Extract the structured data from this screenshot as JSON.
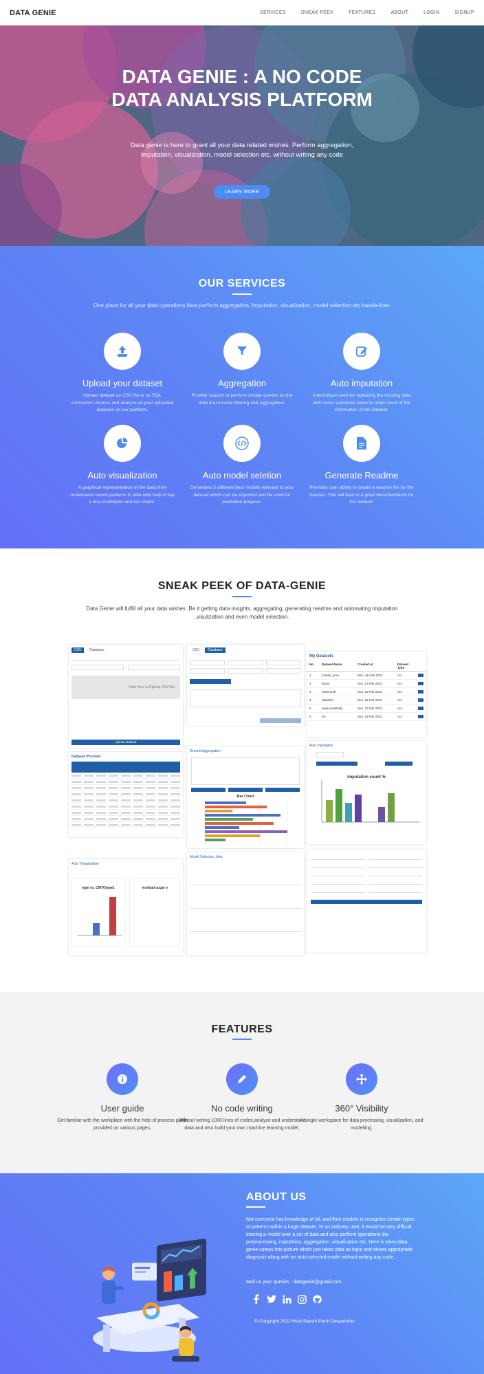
{
  "nav": {
    "brand": "DATA GENIE",
    "links": [
      "SERVICES",
      "SNEAK PEEK",
      "FEATURES",
      "ABOUT",
      "LOGIN",
      "SIGNUP"
    ]
  },
  "hero": {
    "title": "DATA GENIE : A NO CODE DATA ANALYSIS PLATFORM",
    "subtitle": "Data genie is here to grant all your data related wishes. Perform aggregation, imputation, visualization, model selection etc. without writing any code",
    "button": "LEARN MORE"
  },
  "services": {
    "title": "OUR SERVICES",
    "lead": "One place for all your data operations.Now perform aggregation, imputation, visualization, model selection etc.hassle-free.",
    "items": [
      {
        "icon": "upload-icon",
        "name": "Upload your dataset",
        "desc": "Upload dataset as CSV file or as SQL connection.Access and analyze all your uploaded datasets on our platform."
      },
      {
        "icon": "filter-icon",
        "name": "Aggregation",
        "desc": "Provide support to perform simple queries on the data that involve filtering and aggregation."
      },
      {
        "icon": "edit-icon",
        "name": "Auto imputation",
        "desc": "A technique used for replacing the missing data with some substitute value to retain most of the information of the dataset."
      },
      {
        "icon": "pie-chart-icon",
        "name": "Auto visualization",
        "desc": "A graphical representation of the data.Now understand trends,patterns in data with help of top k line,scatterplot and bar charts."
      },
      {
        "icon": "code-icon",
        "name": "Auto model seletion",
        "desc": "Generates 3 different best models relevant to your dataset which can be exported and be used for prediction purpose."
      },
      {
        "icon": "document-icon",
        "name": "Generate Readme",
        "desc": "Provides user ability to create a readme file for the dataset. This will lead to a good documentation for the dataset."
      }
    ]
  },
  "sneak": {
    "title": "SNEAK PEEK OF DATA-GENIE",
    "lead": "Data Genie will fulfill all your data wishes .Be it getting data insights, aggregating, generating readme and automating imputation ,visulization and even model selection.",
    "shots": {
      "upload_click": "Click Here to Upload CSV File",
      "upload_btn": "Upload Dataset",
      "datasets_title": "My Datasets",
      "datasets_headers": [
        "No.",
        "Dataset Name",
        "Created At",
        "Dataset Type"
      ],
      "datasets_rows": [
        [
          "1",
          "mobile_price",
          "Mon, 28 Feb 2022",
          "csv"
        ],
        [
          "2",
          "titanic",
          "Sun, 13 Feb 2022",
          "csv"
        ],
        [
          "3",
          "heart-prob",
          "Sun, 13 Feb 2022",
          "csv"
        ],
        [
          "4",
          "diabetes",
          "Sun, 13 Feb 2022",
          "csv"
        ],
        [
          "5",
          "water-potability",
          "Sun, 13 Feb 2022",
          "csv"
        ],
        [
          "6",
          "iris",
          "Sun, 13 Feb 2022",
          "csv"
        ]
      ],
      "preview_title": "Dataset Preview",
      "aggregation_title": "Ground Aggregation",
      "bar_chart_title": "Bar Chart",
      "imputation_title": "Auto Imputation",
      "imputation_chart_title": "imputation count %",
      "model_title": "Model Selection Jobs",
      "viz_title": "Auto Visualization",
      "scatter_title": "type vs. CMTOtype1",
      "residual_title": "residual sugar v",
      "tabs": [
        "CSV",
        "Database"
      ]
    }
  },
  "features": {
    "title": "FEATURES",
    "items": [
      {
        "icon": "info-icon",
        "name": "User guide",
        "desc": "Get familiar with the workplace with the help of process guide provided on various pages."
      },
      {
        "icon": "pencil-icon",
        "name": "No code writing",
        "desc": "Without writing 1000 lines of codes,analyze and understand data and also build your own machine learning model."
      },
      {
        "icon": "arrows-icon",
        "name": "360° Visibility",
        "desc": "A single workspace for data processing, visualization, and modelling."
      }
    ]
  },
  "about": {
    "title": "ABOUT US",
    "text": "Not everyone has knowledge of ML and their models to recognize certain types of patterns within a huge dataset. To an ordinary user, it would be very difficult training a model over a set of data and also perform operations like preprocessing, imputation, aggregation ,visualization etc. Here is when data genie comes into picture which just takes data as input and shows appropriate diagnosis along with an auto selected model without writing any code.",
    "mail": "Mail us your queries : datagenie@gmail.com",
    "socials": [
      "facebook-icon",
      "twitter-icon",
      "linkedin-icon",
      "instagram-icon",
      "github-icon"
    ],
    "copyright": "© Copyright 2022 Hiral Sakshi Parth Despandhu"
  },
  "colors": {
    "accent": "#4c8df5",
    "gradient_start": "#6370f7",
    "gradient_end": "#5ca8f7"
  }
}
